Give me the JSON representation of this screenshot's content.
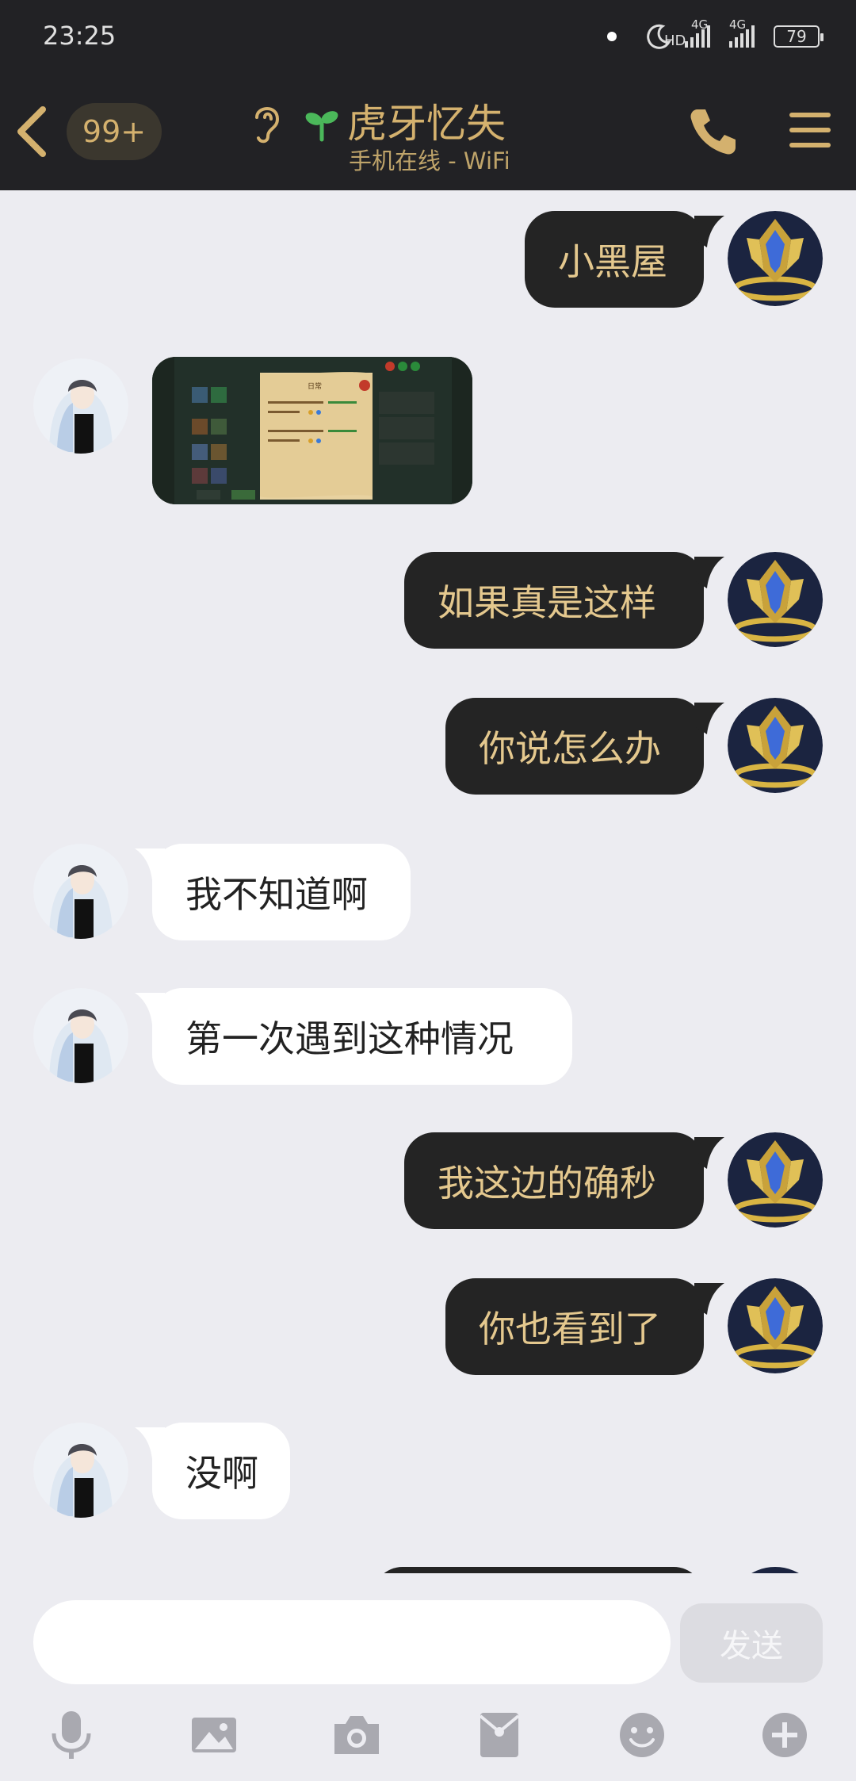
{
  "status": {
    "time": "23:25",
    "hd": "HD",
    "net1": "4G",
    "net2": "4G",
    "battery": "79"
  },
  "header": {
    "unread": "99+",
    "title": "虎牙忆失",
    "subtitle": "手机在线 - WiFi"
  },
  "messages": [
    {
      "side": "me",
      "text": "小黑屋"
    },
    {
      "side": "other",
      "type": "image"
    },
    {
      "side": "me",
      "text": "如果真是这样"
    },
    {
      "side": "me",
      "text": "你说怎么办"
    },
    {
      "side": "other",
      "text": "我不知道啊"
    },
    {
      "side": "other",
      "text": "第一次遇到这种情况"
    },
    {
      "side": "me",
      "text": "我这边的确秒"
    },
    {
      "side": "me",
      "text": "你也看到了"
    },
    {
      "side": "other",
      "text": "没啊"
    }
  ],
  "m0": "小黑屋",
  "m2": "如果真是这样",
  "m3": "你说怎么办",
  "m4": "我不知道啊",
  "m5": "第一次遇到这种情况",
  "m6": "我这边的确秒",
  "m7": "你也看到了",
  "m8": "没啊",
  "image_card": {
    "title": "日常"
  },
  "input": {
    "value": "",
    "placeholder": ""
  },
  "send_label": "发送",
  "toolbar_icons": [
    "microphone-icon",
    "image-icon",
    "camera-icon",
    "red-packet-icon",
    "emoji-icon",
    "plus-icon"
  ],
  "colors": {
    "header_bg": "#222225",
    "accent": "#d4b16e",
    "me_bubble": "#242424",
    "other_bubble": "#ffffff",
    "chat_bg": "#ececf1"
  }
}
